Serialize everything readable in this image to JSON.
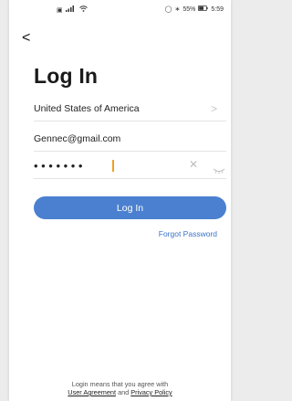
{
  "status_bar": {
    "left_text": "▣ ⁵ᴳ.‡‡l",
    "battery": "55%",
    "time": "5:59"
  },
  "header": {
    "back_glyph": "<",
    "title": "Log In"
  },
  "form": {
    "country": "United States of America",
    "email": "Gennec@gmail.com",
    "password_masked": "•••••••",
    "login_label": "Log In",
    "forgot_label": "Forgot Password"
  },
  "footer": {
    "line1": "Login means that you agree with",
    "agreement": "User Agreement",
    "and": "and",
    "privacy": "Privacy Policy"
  },
  "colors": {
    "accent": "#4a80cf",
    "link": "#3b73c8",
    "caret": "#f0a020"
  },
  "icons": [
    "back-chevron-icon",
    "chevron-right-icon",
    "clear-icon",
    "eye-closed-icon",
    "wifi-icon",
    "signal-icon",
    "battery-icon",
    "alarm-icon",
    "bluetooth-icon"
  ]
}
